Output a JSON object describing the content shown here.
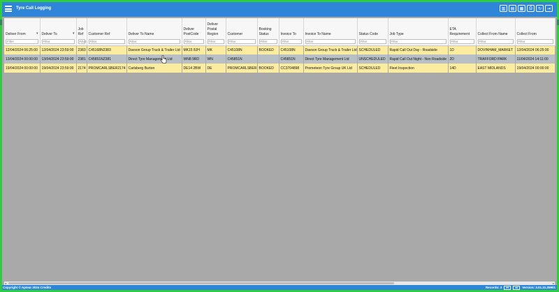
{
  "app": {
    "title": "Tyre Call Logging"
  },
  "toolbar": {
    "icons": [
      "columns-icon",
      "pdf-icon",
      "excel-icon",
      "print-icon",
      "refresh-icon",
      "logout-icon"
    ],
    "glyphs": [
      "▥",
      "▤",
      "▦",
      "⎙",
      "↻",
      "⇥"
    ]
  },
  "filter_placeholder": "Filter",
  "columns": [
    {
      "label": "Deliver From",
      "sort": "▾"
    },
    {
      "label": "Deliver To",
      "sort": "▾"
    },
    {
      "label": "Job Ref",
      "sort": ""
    },
    {
      "label": "Customer Ref",
      "sort": ""
    },
    {
      "label": "Deliver To Name",
      "sort": ""
    },
    {
      "label": "Deliver PostCode",
      "sort": ""
    },
    {
      "label": "Deliver Postal Region",
      "sort": ""
    },
    {
      "label": "Customer",
      "sort": ""
    },
    {
      "label": "Booking Status",
      "sort": ""
    },
    {
      "label": "Invoice To",
      "sort": ""
    },
    {
      "label": "Invoice To Name",
      "sort": ""
    },
    {
      "label": "Status Code",
      "sort": ""
    },
    {
      "label": "Job Type",
      "sort": ""
    },
    {
      "label": "ETA Requirement",
      "sort": ""
    },
    {
      "label": "Collect From Name",
      "sort": ""
    },
    {
      "label": "Collect From",
      "sort": ""
    }
  ],
  "rows": [
    {
      "style": "yellow",
      "cells": [
        "12/04/2024 06:25:00",
        "12/04/2024 23:59:00",
        "2383",
        "C45168N2383",
        "Davson Group Truck & Trailer Ltd",
        "MK15 8JH",
        "MK",
        "C45108N",
        "BOOKED",
        "C45108N",
        "Davson Group Truck & Trailer Ltd",
        "SCHEDULED",
        "Rapid Call Out Day - Roadside",
        "1D",
        "DOVINHAM_MARKET",
        "12/04/2024 06:25:00"
      ]
    },
    {
      "style": "grey",
      "cells": [
        "13/04/2024 00:00:00",
        "13/04/2024 23:59:00",
        "2381",
        "C45851NZ381",
        "Direct Tyre Management Ltd",
        "WN8 9RD",
        "WN",
        "C45851N",
        "",
        "C45851N",
        "Direct Tyre Management Ltd",
        "UNSCHEDULED",
        "Rapid Call Out Night - Non Roadside",
        "2D",
        "TRAFFORD PARK",
        "11/04/2024 14:11:00"
      ]
    },
    {
      "style": "yellow",
      "cells": [
        "19/04/2024 00:00:00",
        "19/04/2024 23:59:00",
        "2174",
        "PROMCARLSBER2174",
        "Carlsberg Burton",
        "DE14 2BW",
        "DE",
        "PROMCARLSBER",
        "BOOKED",
        "CC3704898",
        "Prometeon Tyre Group UK Ltd",
        "SCHEDULED",
        "Fleet Inspection",
        "14D",
        "EAST MIDLANDS",
        "19/04/2024 00:00:00"
      ]
    }
  ],
  "footer": {
    "copyright": "Copyright © Aptear 2024 Credits",
    "records": "Records: 3",
    "version": "Version: 3.01.31.25901"
  }
}
